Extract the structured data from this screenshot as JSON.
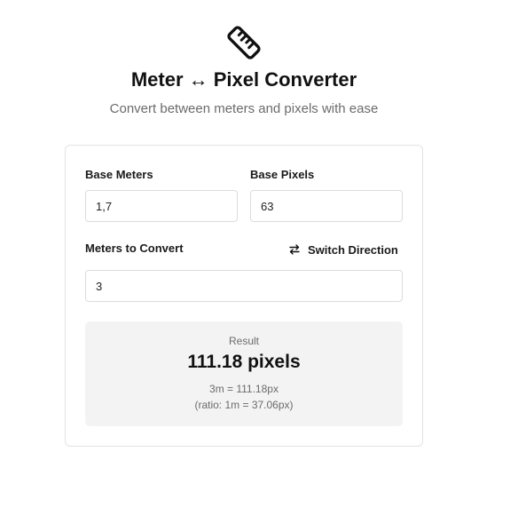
{
  "header": {
    "icon": "ruler-icon",
    "title": "Meter ↔ Pixel Converter",
    "subtitle": "Convert between meters and pixels with ease"
  },
  "form": {
    "base_meters_label": "Base Meters",
    "base_meters_value": "1,7",
    "base_pixels_label": "Base Pixels",
    "base_pixels_value": "63",
    "convert_label": "Meters to Convert",
    "convert_value": "3",
    "switch_label": "Switch Direction",
    "switch_icon": "swap-arrows-icon"
  },
  "result": {
    "label": "Result",
    "value": "111.18 pixels",
    "equation": "3m = 111.18px",
    "ratio": "(ratio: 1m = 37.06px)"
  }
}
